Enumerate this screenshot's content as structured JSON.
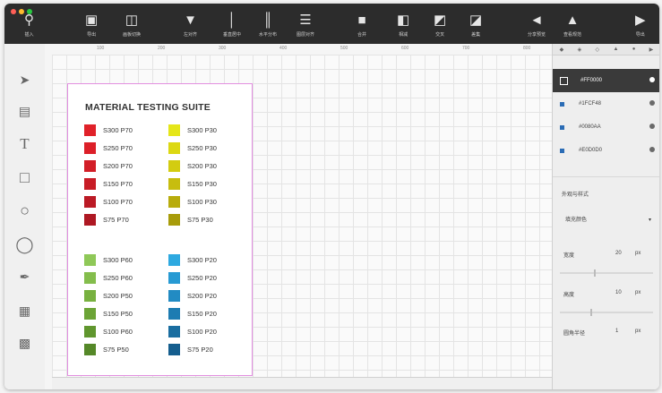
{
  "toolbar": {
    "buttons": [
      {
        "label": "插入",
        "icon": "search-icon"
      },
      {
        "label": "导出",
        "icon": "export-icon"
      },
      {
        "label": "画板切换",
        "icon": "artboard-icon"
      },
      {
        "label": "左对齐",
        "icon": "align-left-icon"
      },
      {
        "label": "垂直居中",
        "icon": "align-center-icon"
      },
      {
        "label": "水平分布",
        "icon": "distribute-icon"
      },
      {
        "label": "图层对齐",
        "icon": "layer-align-icon"
      },
      {
        "label": "合并",
        "icon": "union-icon"
      },
      {
        "label": "相减",
        "icon": "subtract-icon"
      },
      {
        "label": "交叉",
        "icon": "intersect-icon"
      },
      {
        "label": "差集",
        "icon": "difference-icon"
      },
      {
        "label": "分享预览",
        "icon": "share-icon"
      },
      {
        "label": "查看规范",
        "icon": "inspect-icon"
      },
      {
        "label": "导出",
        "icon": "export-right-icon"
      }
    ],
    "colors": {
      "red": "#ff5f57",
      "yellow": "#febc2e",
      "green": "#28c840"
    }
  },
  "ruler": {
    "marks": [
      "100",
      "200",
      "300",
      "400",
      "500",
      "600",
      "700",
      "800"
    ]
  },
  "artboard": {
    "title": "MATERIAL TESTING SUITE",
    "columns": [
      {
        "items": [
          {
            "label": "S300 P70",
            "color": "#e02129"
          },
          {
            "label": "S250 P70",
            "color": "#dc1f28"
          },
          {
            "label": "S200 P70",
            "color": "#d21e27"
          },
          {
            "label": "S150 P70",
            "color": "#c81c26"
          },
          {
            "label": "S100 P70",
            "color": "#bb1a25"
          },
          {
            "label": "S75 P70",
            "color": "#ae1823"
          }
        ]
      },
      {
        "items": [
          {
            "label": "S300 P30",
            "color": "#e5e619"
          },
          {
            "label": "S250 P30",
            "color": "#dcd812"
          },
          {
            "label": "S200 P30",
            "color": "#d3cc10"
          },
          {
            "label": "S150 P30",
            "color": "#c7bd0f"
          },
          {
            "label": "S100 P30",
            "color": "#b8ac0d"
          },
          {
            "label": "S75 P30",
            "color": "#a89c0b"
          }
        ]
      },
      {
        "items": [
          {
            "label": "S300 P60",
            "color": "#8fc858"
          },
          {
            "label": "S250 P60",
            "color": "#84bd4c"
          },
          {
            "label": "S200 P50",
            "color": "#78b140"
          },
          {
            "label": "S150 P50",
            "color": "#6ca436"
          },
          {
            "label": "S100 P60",
            "color": "#60962e"
          },
          {
            "label": "S75 P50",
            "color": "#558828"
          }
        ]
      },
      {
        "items": [
          {
            "label": "S300 P20",
            "color": "#2ea9e0"
          },
          {
            "label": "S250 P20",
            "color": "#279ad3"
          },
          {
            "label": "S200 P20",
            "color": "#228bc3"
          },
          {
            "label": "S150 P20",
            "color": "#1d7cb2"
          },
          {
            "label": "S100 P20",
            "color": "#196da0"
          },
          {
            "label": "S75 P20",
            "color": "#155e8e"
          }
        ]
      }
    ]
  },
  "panel": {
    "header": [
      "◆",
      "◈",
      "◇",
      "▲",
      "●",
      "▶"
    ],
    "layers": [
      {
        "name": "#FF0000",
        "selected": true
      },
      {
        "name": "#1FCF48",
        "selected": false
      },
      {
        "name": "#0080AA",
        "selected": false
      },
      {
        "name": "#E0D0D0",
        "selected": false
      }
    ],
    "section_title": "外观与样式",
    "dropdown": "填充颜色",
    "field1": {
      "label": "宽度",
      "value": "20",
      "unit": "px"
    },
    "field2": {
      "label": "高度",
      "value": "10",
      "unit": "px"
    },
    "field3": {
      "label": "圆角半径",
      "value": "1",
      "unit": "px"
    }
  }
}
